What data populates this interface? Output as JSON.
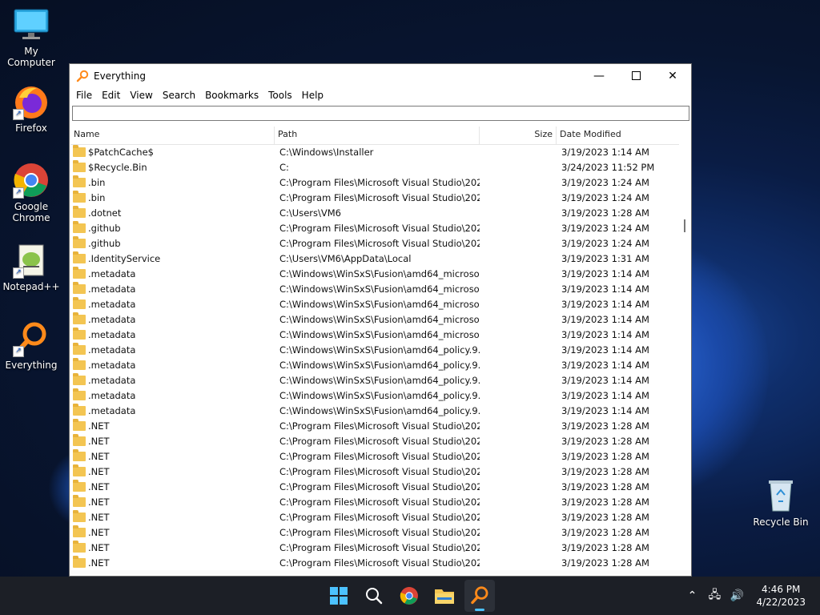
{
  "desktop": {
    "icons": [
      {
        "label": "My Computer"
      },
      {
        "label": "Firefox"
      },
      {
        "label": "Google Chrome"
      },
      {
        "label": "Notepad++"
      },
      {
        "label": "Everything"
      },
      {
        "label": "Recycle Bin"
      }
    ]
  },
  "window": {
    "title": "Everything",
    "menu": [
      "File",
      "Edit",
      "View",
      "Search",
      "Bookmarks",
      "Tools",
      "Help"
    ],
    "search": {
      "value": "",
      "placeholder": ""
    },
    "columns": {
      "name": "Name",
      "path": "Path",
      "size": "Size",
      "date": "Date Modified"
    },
    "rows": [
      {
        "name": "$PatchCache$",
        "path": "C:\\Windows\\Installer",
        "size": "",
        "date": "3/19/2023 1:14 AM"
      },
      {
        "name": "$Recycle.Bin",
        "path": "C:",
        "size": "",
        "date": "3/24/2023 11:52 PM"
      },
      {
        "name": ".bin",
        "path": "C:\\Program Files\\Microsoft Visual Studio\\202...",
        "size": "",
        "date": "3/19/2023 1:24 AM"
      },
      {
        "name": ".bin",
        "path": "C:\\Program Files\\Microsoft Visual Studio\\202...",
        "size": "",
        "date": "3/19/2023 1:24 AM"
      },
      {
        "name": ".dotnet",
        "path": "C:\\Users\\VM6",
        "size": "",
        "date": "3/19/2023 1:28 AM"
      },
      {
        "name": ".github",
        "path": "C:\\Program Files\\Microsoft Visual Studio\\202...",
        "size": "",
        "date": "3/19/2023 1:24 AM"
      },
      {
        "name": ".github",
        "path": "C:\\Program Files\\Microsoft Visual Studio\\202...",
        "size": "",
        "date": "3/19/2023 1:24 AM"
      },
      {
        "name": ".IdentityService",
        "path": "C:\\Users\\VM6\\AppData\\Local",
        "size": "",
        "date": "3/19/2023 1:31 AM"
      },
      {
        "name": ".metadata",
        "path": "C:\\Windows\\WinSxS\\Fusion\\amd64_microso...",
        "size": "",
        "date": "3/19/2023 1:14 AM"
      },
      {
        "name": ".metadata",
        "path": "C:\\Windows\\WinSxS\\Fusion\\amd64_microso...",
        "size": "",
        "date": "3/19/2023 1:14 AM"
      },
      {
        "name": ".metadata",
        "path": "C:\\Windows\\WinSxS\\Fusion\\amd64_microso...",
        "size": "",
        "date": "3/19/2023 1:14 AM"
      },
      {
        "name": ".metadata",
        "path": "C:\\Windows\\WinSxS\\Fusion\\amd64_microso...",
        "size": "",
        "date": "3/19/2023 1:14 AM"
      },
      {
        "name": ".metadata",
        "path": "C:\\Windows\\WinSxS\\Fusion\\amd64_microso...",
        "size": "",
        "date": "3/19/2023 1:14 AM"
      },
      {
        "name": ".metadata",
        "path": "C:\\Windows\\WinSxS\\Fusion\\amd64_policy.9....",
        "size": "",
        "date": "3/19/2023 1:14 AM"
      },
      {
        "name": ".metadata",
        "path": "C:\\Windows\\WinSxS\\Fusion\\amd64_policy.9....",
        "size": "",
        "date": "3/19/2023 1:14 AM"
      },
      {
        "name": ".metadata",
        "path": "C:\\Windows\\WinSxS\\Fusion\\amd64_policy.9....",
        "size": "",
        "date": "3/19/2023 1:14 AM"
      },
      {
        "name": ".metadata",
        "path": "C:\\Windows\\WinSxS\\Fusion\\amd64_policy.9....",
        "size": "",
        "date": "3/19/2023 1:14 AM"
      },
      {
        "name": ".metadata",
        "path": "C:\\Windows\\WinSxS\\Fusion\\amd64_policy.9....",
        "size": "",
        "date": "3/19/2023 1:14 AM"
      },
      {
        "name": ".NET",
        "path": "C:\\Program Files\\Microsoft Visual Studio\\202...",
        "size": "",
        "date": "3/19/2023 1:28 AM"
      },
      {
        "name": ".NET",
        "path": "C:\\Program Files\\Microsoft Visual Studio\\202...",
        "size": "",
        "date": "3/19/2023 1:28 AM"
      },
      {
        "name": ".NET",
        "path": "C:\\Program Files\\Microsoft Visual Studio\\202...",
        "size": "",
        "date": "3/19/2023 1:28 AM"
      },
      {
        "name": ".NET",
        "path": "C:\\Program Files\\Microsoft Visual Studio\\202...",
        "size": "",
        "date": "3/19/2023 1:28 AM"
      },
      {
        "name": ".NET",
        "path": "C:\\Program Files\\Microsoft Visual Studio\\202...",
        "size": "",
        "date": "3/19/2023 1:28 AM"
      },
      {
        "name": ".NET",
        "path": "C:\\Program Files\\Microsoft Visual Studio\\202...",
        "size": "",
        "date": "3/19/2023 1:28 AM"
      },
      {
        "name": ".NET",
        "path": "C:\\Program Files\\Microsoft Visual Studio\\202...",
        "size": "",
        "date": "3/19/2023 1:28 AM"
      },
      {
        "name": ".NET",
        "path": "C:\\Program Files\\Microsoft Visual Studio\\202...",
        "size": "",
        "date": "3/19/2023 1:28 AM"
      },
      {
        "name": ".NET",
        "path": "C:\\Program Files\\Microsoft Visual Studio\\202...",
        "size": "",
        "date": "3/19/2023 1:28 AM"
      },
      {
        "name": ".NET",
        "path": "C:\\Program Files\\Microsoft Visual Studio\\202...",
        "size": "",
        "date": "3/19/2023 1:28 AM"
      }
    ]
  },
  "taskbar": {
    "items": [
      "start-icon",
      "search-icon",
      "chrome-icon",
      "file-explorer-icon",
      "everything-icon"
    ],
    "clock": {
      "time": "4:46 PM",
      "date": "4/22/2023"
    }
  },
  "colors": {
    "accent": "#4cc2ff",
    "taskbar": "#1c1f26",
    "folder": "#f3c552"
  }
}
